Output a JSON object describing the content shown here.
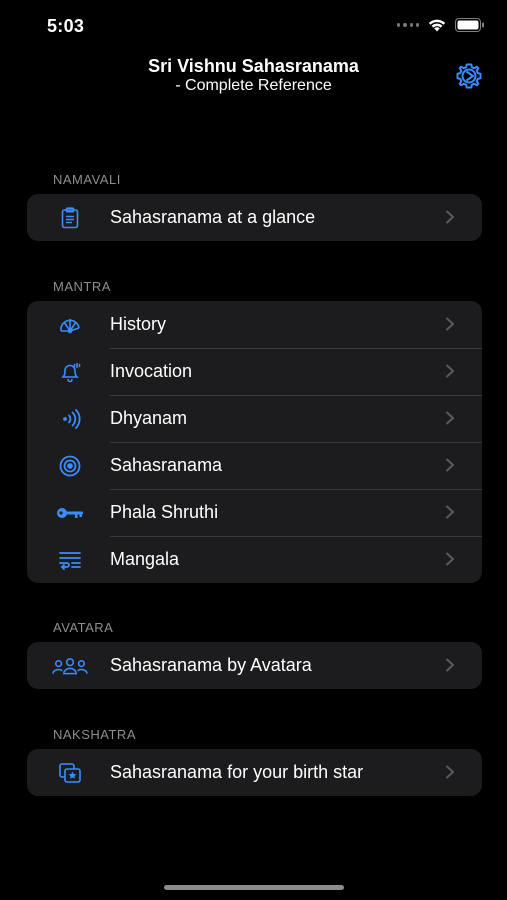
{
  "status_bar": {
    "time": "5:03"
  },
  "header": {
    "title": "Sri Vishnu Sahasranama",
    "subtitle": "- Complete Reference"
  },
  "colors": {
    "accent": "#3b8cff",
    "background": "#000000",
    "group_bg": "#1c1c1e",
    "section_label": "#8e8e93"
  },
  "sections": [
    {
      "label": "NAMAVALI",
      "items": [
        {
          "label": "Sahasranama at a glance",
          "icon": "clipboard-icon"
        }
      ]
    },
    {
      "label": "MANTRA",
      "items": [
        {
          "label": "History",
          "icon": "nautilus-icon"
        },
        {
          "label": "Invocation",
          "icon": "bell-icon"
        },
        {
          "label": "Dhyanam",
          "icon": "sound-waves-icon"
        },
        {
          "label": "Sahasranama",
          "icon": "target-icon"
        },
        {
          "label": "Phala Shruthi",
          "icon": "key-icon"
        },
        {
          "label": "Mangala",
          "icon": "text-wrap-icon"
        }
      ]
    },
    {
      "label": "AVATARA",
      "items": [
        {
          "label": "Sahasranama by Avatara",
          "icon": "people-icon"
        }
      ]
    },
    {
      "label": "NAKSHATRA",
      "items": [
        {
          "label": "Sahasranama for your birth star",
          "icon": "star-square-icon"
        }
      ]
    }
  ]
}
